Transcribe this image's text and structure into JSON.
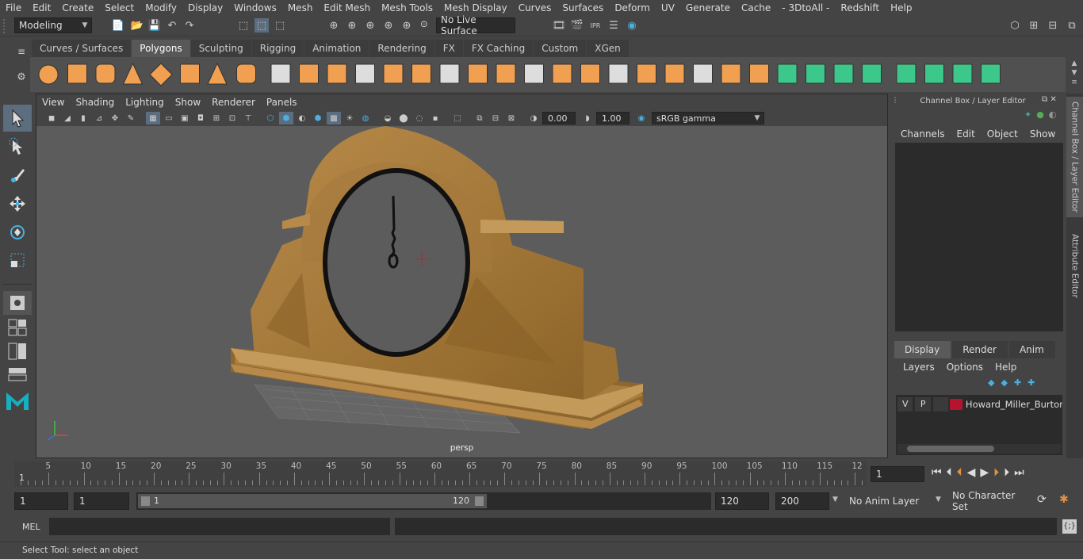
{
  "menubar": {
    "items": [
      "File",
      "Edit",
      "Create",
      "Select",
      "Modify",
      "Display",
      "Windows",
      "Mesh",
      "Edit Mesh",
      "Mesh Tools",
      "Mesh Display",
      "Curves",
      "Surfaces",
      "Deform",
      "UV",
      "Generate",
      "Cache",
      "- 3DtoAll -",
      "Redshift",
      "Help"
    ]
  },
  "status": {
    "mode": "Modeling",
    "live_surface": "No Live Surface"
  },
  "shelf": {
    "tabs": [
      "Curves / Surfaces",
      "Polygons",
      "Sculpting",
      "Rigging",
      "Animation",
      "Rendering",
      "FX",
      "FX Caching",
      "Custom",
      "XGen"
    ],
    "active_tab": "Polygons",
    "accent": "#f0a050",
    "accent_green": "#3cc88a"
  },
  "panel": {
    "menu": [
      "View",
      "Shading",
      "Lighting",
      "Show",
      "Renderer",
      "Panels"
    ],
    "exposure": "0.00",
    "gamma": "1.00",
    "color_space": "sRGB gamma",
    "camera_label": "persp"
  },
  "channel_box": {
    "title": "Channel Box / Layer Editor",
    "menu": [
      "Channels",
      "Edit",
      "Object",
      "Show"
    ]
  },
  "layer_editor": {
    "tabs": [
      "Display",
      "Render",
      "Anim"
    ],
    "active_tab": "Display",
    "menu": [
      "Layers",
      "Options",
      "Help"
    ],
    "layer": {
      "visible": "V",
      "playback": "P",
      "name": "Howard_Miller_Burton",
      "color": "#b5132e"
    }
  },
  "side_tabs": {
    "channel": "Channel Box / Layer Editor",
    "attribute": "Attribute Editor"
  },
  "timeline": {
    "ticks": [
      "5",
      "10",
      "15",
      "20",
      "25",
      "30",
      "35",
      "40",
      "45",
      "50",
      "55",
      "60",
      "65",
      "70",
      "75",
      "80",
      "85",
      "90",
      "95",
      "100",
      "105",
      "110",
      "115",
      "12"
    ],
    "start_label": "1",
    "current_frame": "1"
  },
  "range": {
    "start": "1",
    "playback_start": "1",
    "slider_start": "1",
    "slider_end": "120",
    "playback_end": "120",
    "end": "200",
    "anim_layer": "No Anim Layer",
    "character_set": "No Character Set"
  },
  "cmdline": {
    "label": "MEL"
  },
  "helpline": {
    "text": "Select Tool: select an object"
  }
}
